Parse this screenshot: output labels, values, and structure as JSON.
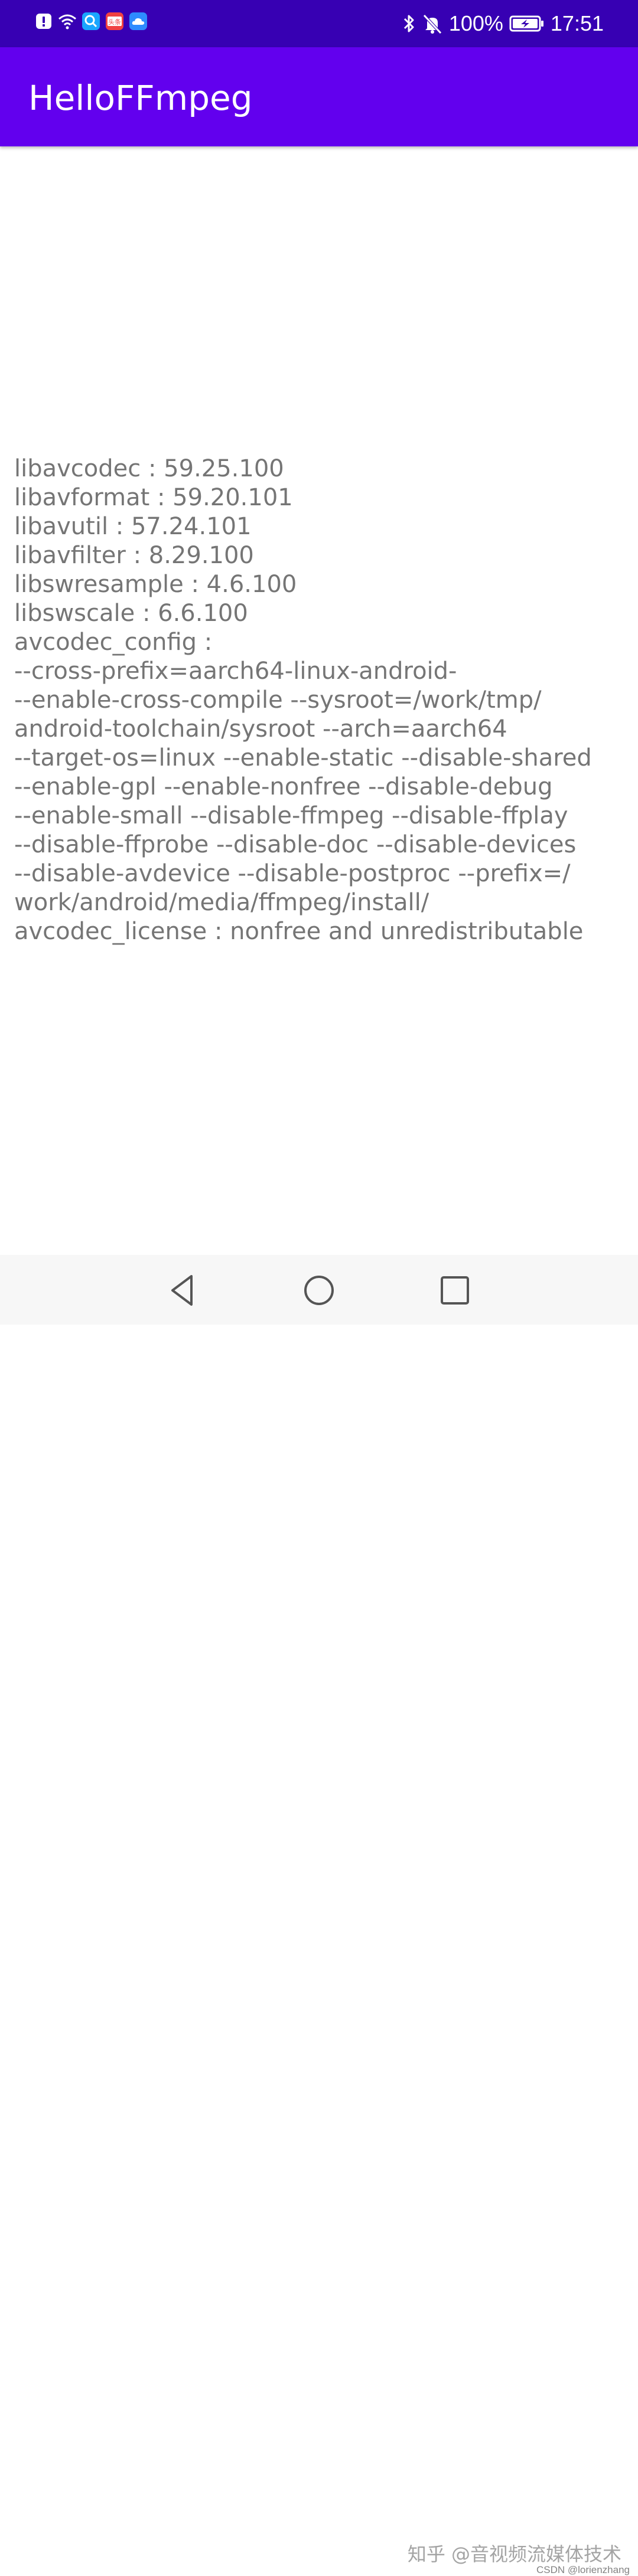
{
  "status_bar": {
    "battery_percent": "100%",
    "time": "17:51",
    "toutiao_label": "头条",
    "icons": [
      "alert-icon",
      "wifi-icon",
      "search-app-icon",
      "toutiao-app-icon",
      "cloud-app-icon",
      "bluetooth-icon",
      "bell-muted-icon",
      "battery-charging-icon"
    ]
  },
  "app_bar": {
    "title": "HelloFFmpeg",
    "color": "#6200ee"
  },
  "colors": {
    "status_bar": "#3700b3",
    "text": "#757575"
  },
  "content": {
    "lines": [
      "libavcodec : 59.25.100",
      "libavformat : 59.20.101",
      "libavutil : 57.24.101",
      "libavfilter : 8.29.100",
      "libswresample : 4.6.100",
      "libswscale : 6.6.100",
      "avcodec_config :",
      "--cross-prefix=aarch64-linux-android-",
      "--enable-cross-compile --sysroot=/work/tmp/",
      "android-toolchain/sysroot --arch=aarch64",
      "--target-os=linux --enable-static --disable-shared",
      "--enable-gpl --enable-nonfree --disable-debug",
      "--enable-small --disable-ffmpeg --disable-ffplay",
      "--disable-ffprobe --disable-doc --disable-devices",
      "--disable-avdevice --disable-postproc --prefix=/",
      "work/android/media/ffmpeg/install/",
      "avcodec_license : nonfree and unredistributable"
    ]
  },
  "nav_bar": {
    "buttons": [
      "back-icon",
      "home-icon",
      "recents-icon"
    ]
  },
  "watermark": {
    "text": "知乎 @音视频流媒体技术",
    "credit": "CSDN @lorienzhang"
  }
}
